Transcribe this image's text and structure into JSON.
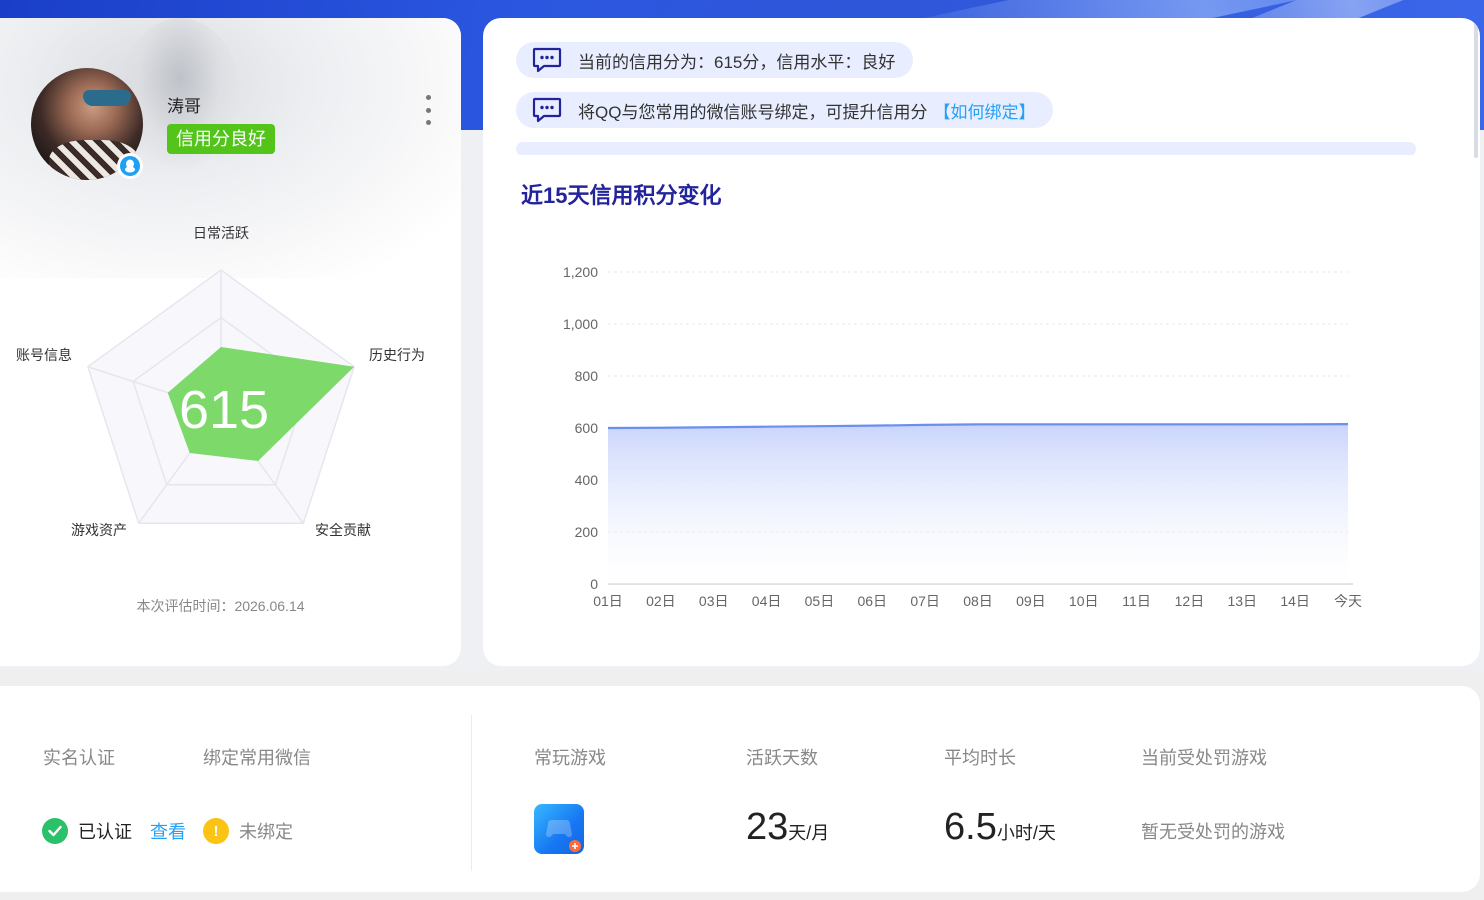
{
  "profile": {
    "username": "涛哥",
    "credit_tag": "信用分良好",
    "score_display": "615",
    "eval_time": "本次评估时间：2026.06.14",
    "radar": {
      "axes": [
        "日常活跃",
        "历史行为",
        "安全贡献",
        "游戏资产",
        "账号信息"
      ],
      "values": [
        0.45,
        1.0,
        0.45,
        0.38,
        0.4
      ],
      "fill_color": "#6fd65a"
    }
  },
  "notices": [
    {
      "text": "当前的信用分为：615分，信用水平：良好",
      "link": ""
    },
    {
      "text": "将QQ与您常用的微信账号绑定，可提升信用分",
      "link": "【如何绑定】"
    }
  ],
  "chart_data": {
    "type": "area",
    "title": "近15天信用积分变化",
    "categories": [
      "01日",
      "02日",
      "03日",
      "04日",
      "05日",
      "06日",
      "07日",
      "08日",
      "09日",
      "10日",
      "11日",
      "12日",
      "13日",
      "14日",
      "今天"
    ],
    "series": [
      {
        "values": [
          600,
          601,
          603,
          605,
          607,
          609,
          612,
          614,
          614,
          614,
          614,
          614,
          614,
          614,
          615
        ]
      }
    ],
    "ylim": [
      0,
      1200
    ],
    "yticks": [
      "0",
      "200",
      "400",
      "600",
      "800",
      "1,000",
      "1,200"
    ],
    "grid": true,
    "line_color": "#6a8ff0"
  },
  "stats": {
    "real_name_label": "实名认证",
    "real_name_status": "已认证",
    "real_name_link": "查看",
    "wechat_label": "绑定常用微信",
    "wechat_status": "未绑定",
    "game_label": "常玩游戏",
    "active_label": "活跃天数",
    "active_value": "23",
    "active_unit": "天/月",
    "avg_label": "平均时长",
    "avg_value": "6.5",
    "avg_unit": "小时/天",
    "punish_label": "当前受处罚游戏",
    "punish_value": "暂无受处罚的游戏"
  },
  "colors": {
    "green": "#52c41a",
    "link": "#25a0f5",
    "warn": "#fbc313",
    "title": "#23239b"
  },
  "icons": [
    "qq-icon",
    "more-icon",
    "message-icon",
    "check-icon",
    "warning-icon",
    "game-icon"
  ]
}
